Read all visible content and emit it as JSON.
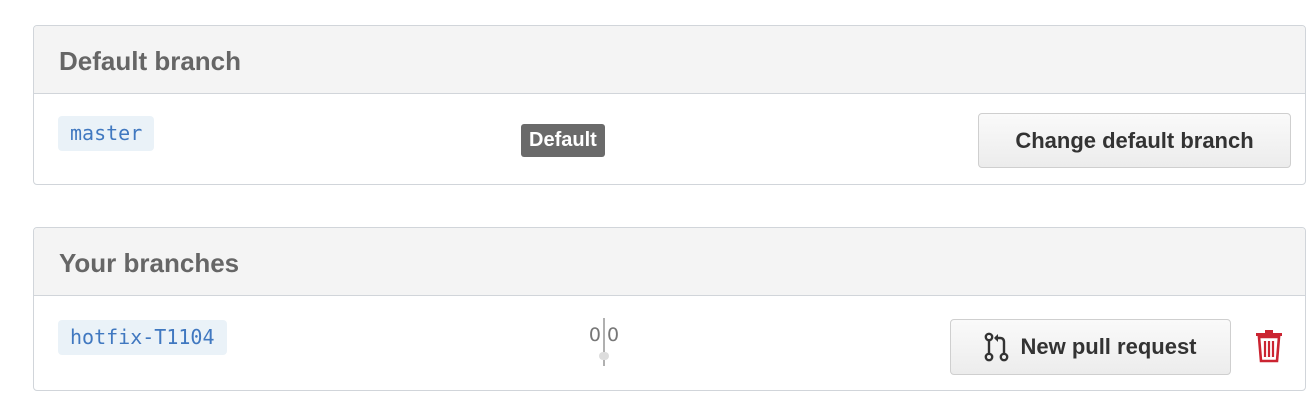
{
  "default_section": {
    "title": "Default branch",
    "branch_name": "master",
    "default_label": "Default",
    "change_button_label": "Change default branch"
  },
  "your_section": {
    "title": "Your branches",
    "branches": [
      {
        "name": "hotfix-T1104",
        "behind": "0",
        "ahead": "0",
        "pull_request_label": "New pull request"
      }
    ]
  },
  "colors": {
    "branch_link": "#4078c0",
    "branch_bg": "#eaf2f8",
    "default_label_bg": "#6a6a6a",
    "delete_icon": "#cb2431",
    "header_bg": "#f4f4f4"
  },
  "icons": {
    "pull_request": "git-pull-request-icon",
    "delete": "trash-icon"
  }
}
